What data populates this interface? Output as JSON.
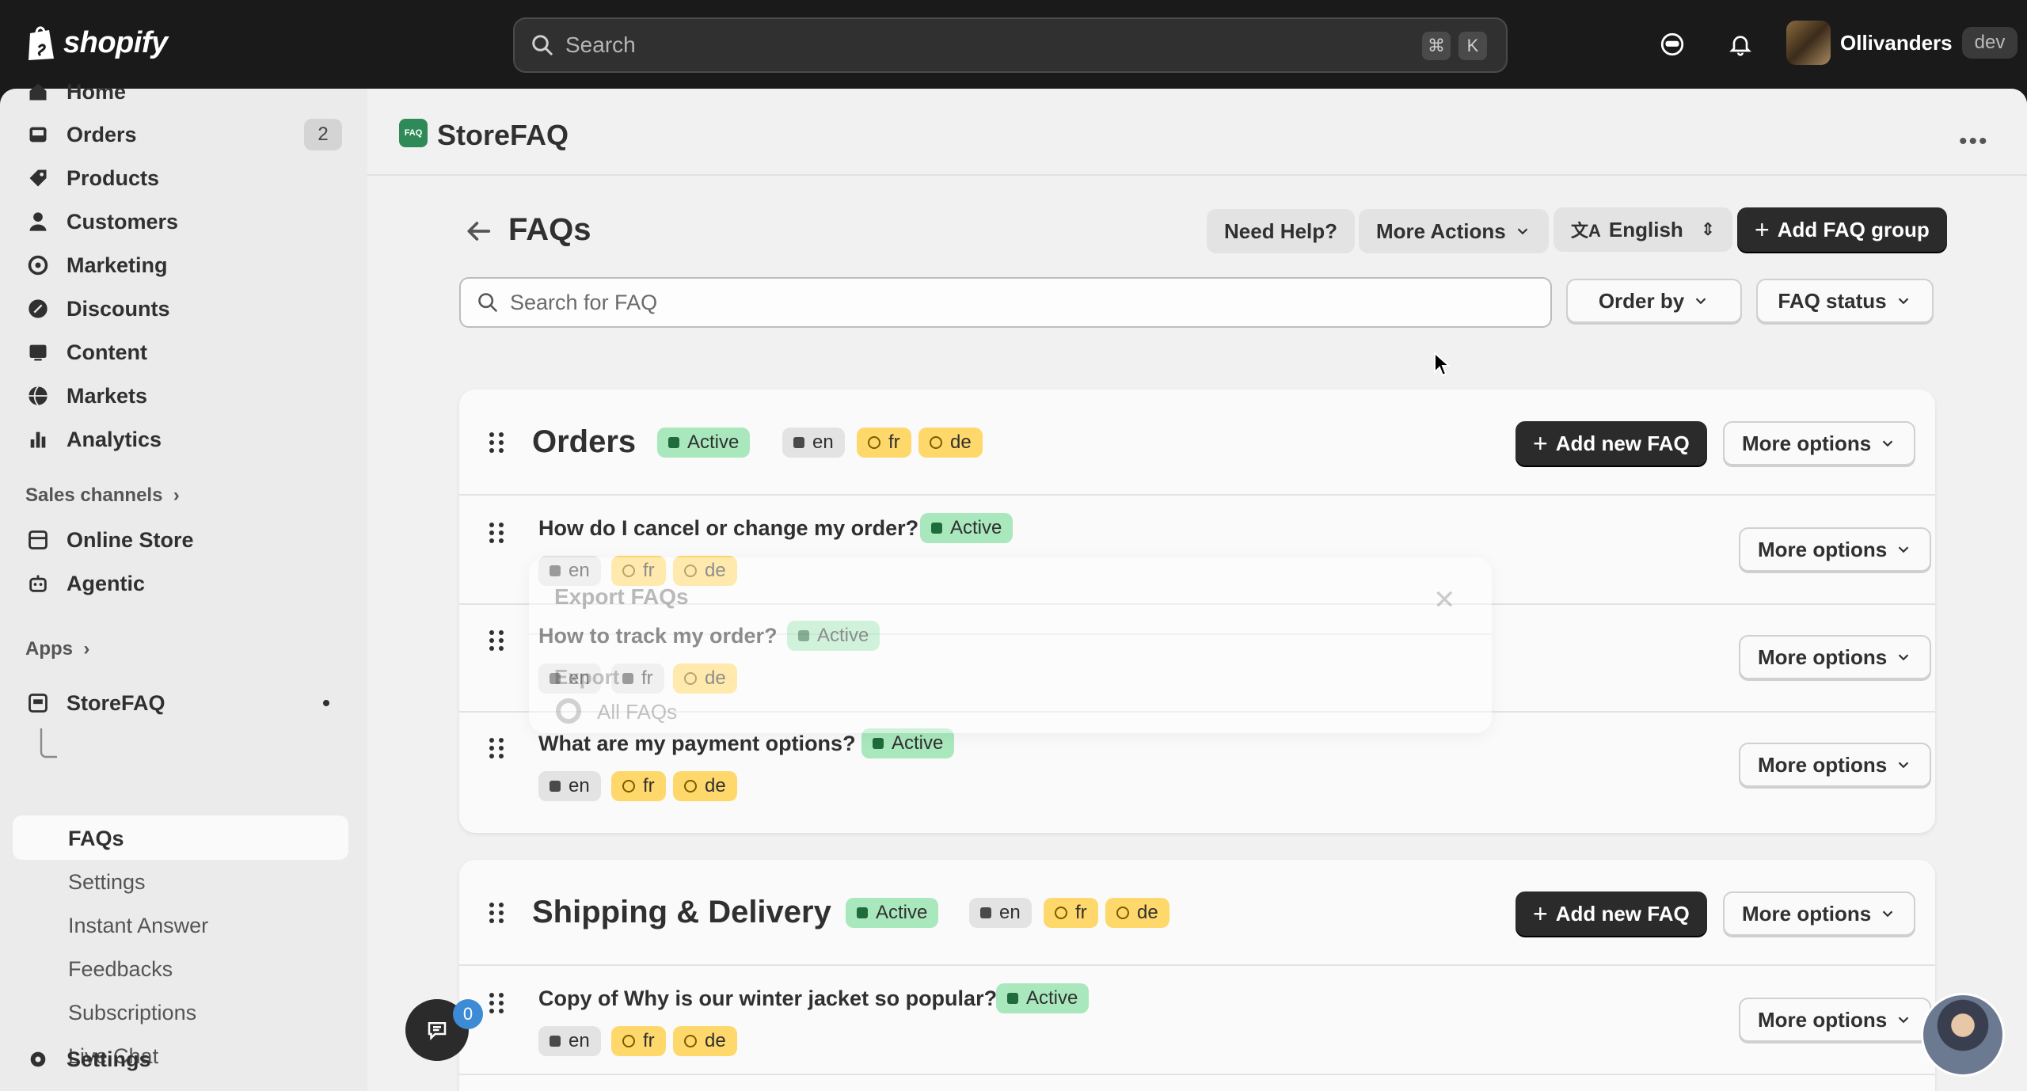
{
  "topbar": {
    "brand": "shopify",
    "search_placeholder": "Search",
    "shortcut_cmd": "⌘",
    "shortcut_key": "K",
    "user_name": "Ollivanders",
    "store_badge": "dev"
  },
  "sidebar": {
    "items": [
      {
        "label": "Home",
        "icon": "home-icon"
      },
      {
        "label": "Orders",
        "icon": "inbox-icon",
        "count": "2"
      },
      {
        "label": "Products",
        "icon": "tag-icon"
      },
      {
        "label": "Customers",
        "icon": "person-icon"
      },
      {
        "label": "Marketing",
        "icon": "target-icon"
      },
      {
        "label": "Discounts",
        "icon": "discount-icon"
      },
      {
        "label": "Content",
        "icon": "content-icon"
      },
      {
        "label": "Markets",
        "icon": "globe-icon"
      },
      {
        "label": "Analytics",
        "icon": "bar-chart-icon"
      }
    ],
    "sales_channels_label": "Sales channels",
    "sales_channels": [
      {
        "label": "Online Store",
        "icon": "store-icon"
      },
      {
        "label": "Agentic",
        "icon": "robot-icon"
      }
    ],
    "apps_label": "Apps",
    "app_name": "StoreFAQ",
    "app_sub": [
      "FAQs",
      "Settings",
      "Instant Answer",
      "Feedbacks",
      "Subscriptions",
      "Live Chat"
    ],
    "settings_label": "Settings"
  },
  "app": {
    "title": "StoreFAQ",
    "logo_text": "FAQ",
    "page_title": "FAQs",
    "need_help": "Need Help?",
    "more_actions": "More Actions",
    "language": "English",
    "add_group": "Add FAQ group",
    "search_placeholder": "Search for FAQ",
    "order_by": "Order by",
    "faq_status": "FAQ status"
  },
  "labels": {
    "active": "Active",
    "en": "en",
    "fr": "fr",
    "de": "de",
    "add_new_faq": "Add new FAQ",
    "more_options": "More options"
  },
  "groups": [
    {
      "title": "Orders",
      "faqs": [
        "How do I cancel or change my order?",
        "How to track my order?",
        "What are my payment options?"
      ]
    },
    {
      "title": "Shipping & Delivery",
      "faqs": [
        "Copy of Why is our winter jacket so popular?"
      ]
    }
  ],
  "ghost_modal": {
    "title": "Export FAQs",
    "export_label": "Export",
    "option": "All FAQs"
  },
  "chat": {
    "count": "0"
  },
  "colors": {
    "active_badge": "#a9e8bd",
    "lang_badge": "#ffd86b",
    "primary": "#2b2b2b"
  }
}
